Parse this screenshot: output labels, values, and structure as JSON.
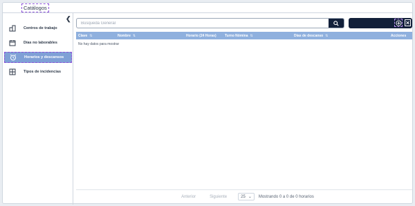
{
  "breadcrumb": {
    "label": "Catálogos"
  },
  "sidebar": {
    "collapse_icon": "chevron-left-icon",
    "items": [
      {
        "label": "Centros de trabajo",
        "icon": "building-icon",
        "active": false
      },
      {
        "label": "Días no laborables",
        "icon": "calendar-icon",
        "active": false
      },
      {
        "label": "Horarios y descansos",
        "icon": "alarm-clock-icon",
        "active": true
      },
      {
        "label": "Tipos de incidencias",
        "icon": "grid-icon",
        "active": false
      }
    ]
  },
  "search": {
    "placeholder": "Búsqueda General",
    "value": ""
  },
  "table": {
    "columns": [
      {
        "label": "Clave",
        "sortable": true
      },
      {
        "label": "Nombre",
        "sortable": true
      },
      {
        "label": "Horario (24 Horas)",
        "sortable": false
      },
      {
        "label": "Turno Nómina",
        "sortable": true
      },
      {
        "label": "Días de descanso",
        "sortable": true
      },
      {
        "label": "Acciones",
        "sortable": false
      }
    ],
    "sort_glyph": "⇅",
    "empty_message": "No hay datos para mostrar"
  },
  "pagination": {
    "previous": "Anterior",
    "next": "Siguiente",
    "page_size": "25",
    "summary": "Mostrando 0 a 0 de 0 horarios"
  },
  "colors": {
    "accent_dark": "#12203a",
    "header_blue": "#8fb0de",
    "active_item": "#7fa0d6"
  }
}
